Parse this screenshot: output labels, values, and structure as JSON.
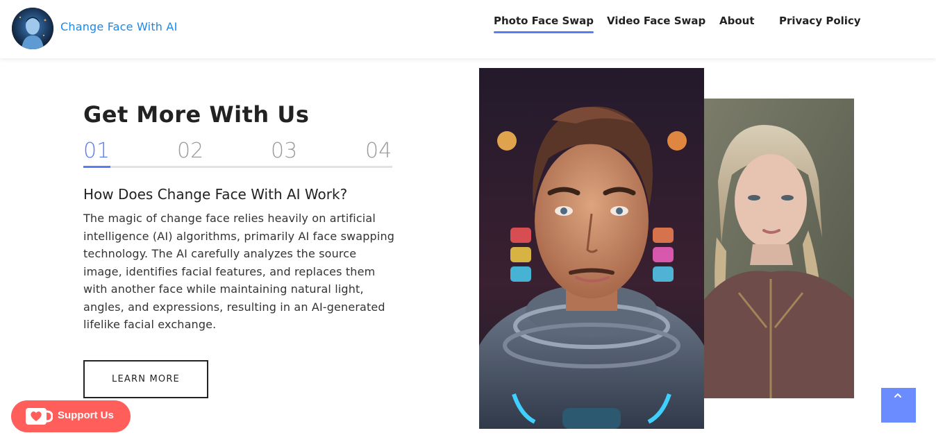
{
  "header": {
    "brand": "Change Face With AI",
    "nav": [
      {
        "label": "Photo Face Swap",
        "active": true
      },
      {
        "label": "Video Face Swap",
        "active": false
      },
      {
        "label": "About",
        "active": false
      },
      {
        "label": "Privacy Policy",
        "active": false
      }
    ]
  },
  "main": {
    "heading": "Get More With Us",
    "steps": [
      "01",
      "02",
      "03",
      "04"
    ],
    "active_step": "01",
    "subheading": "How Does Change Face With AI Work?",
    "paragraph": "The magic of change face relies heavily on artificial intelligence (AI) algorithms, primarily AI face swapping technology. The AI carefully analyzes the source image, identifies facial features, and replaces them with another face while maintaining natural light, angles, and expressions, resulting in an AI-generated lifelike facial exchange.",
    "learn_more": "LEARN MORE"
  },
  "support": {
    "label": "Support Us"
  },
  "scroll_top": {
    "icon": "chevron-up-icon"
  },
  "colors": {
    "accent": "#5b7cf0",
    "brand_text": "#1e88e5",
    "support_bg": "#ff5e5b",
    "scroll_top_bg": "#6b8cff"
  }
}
